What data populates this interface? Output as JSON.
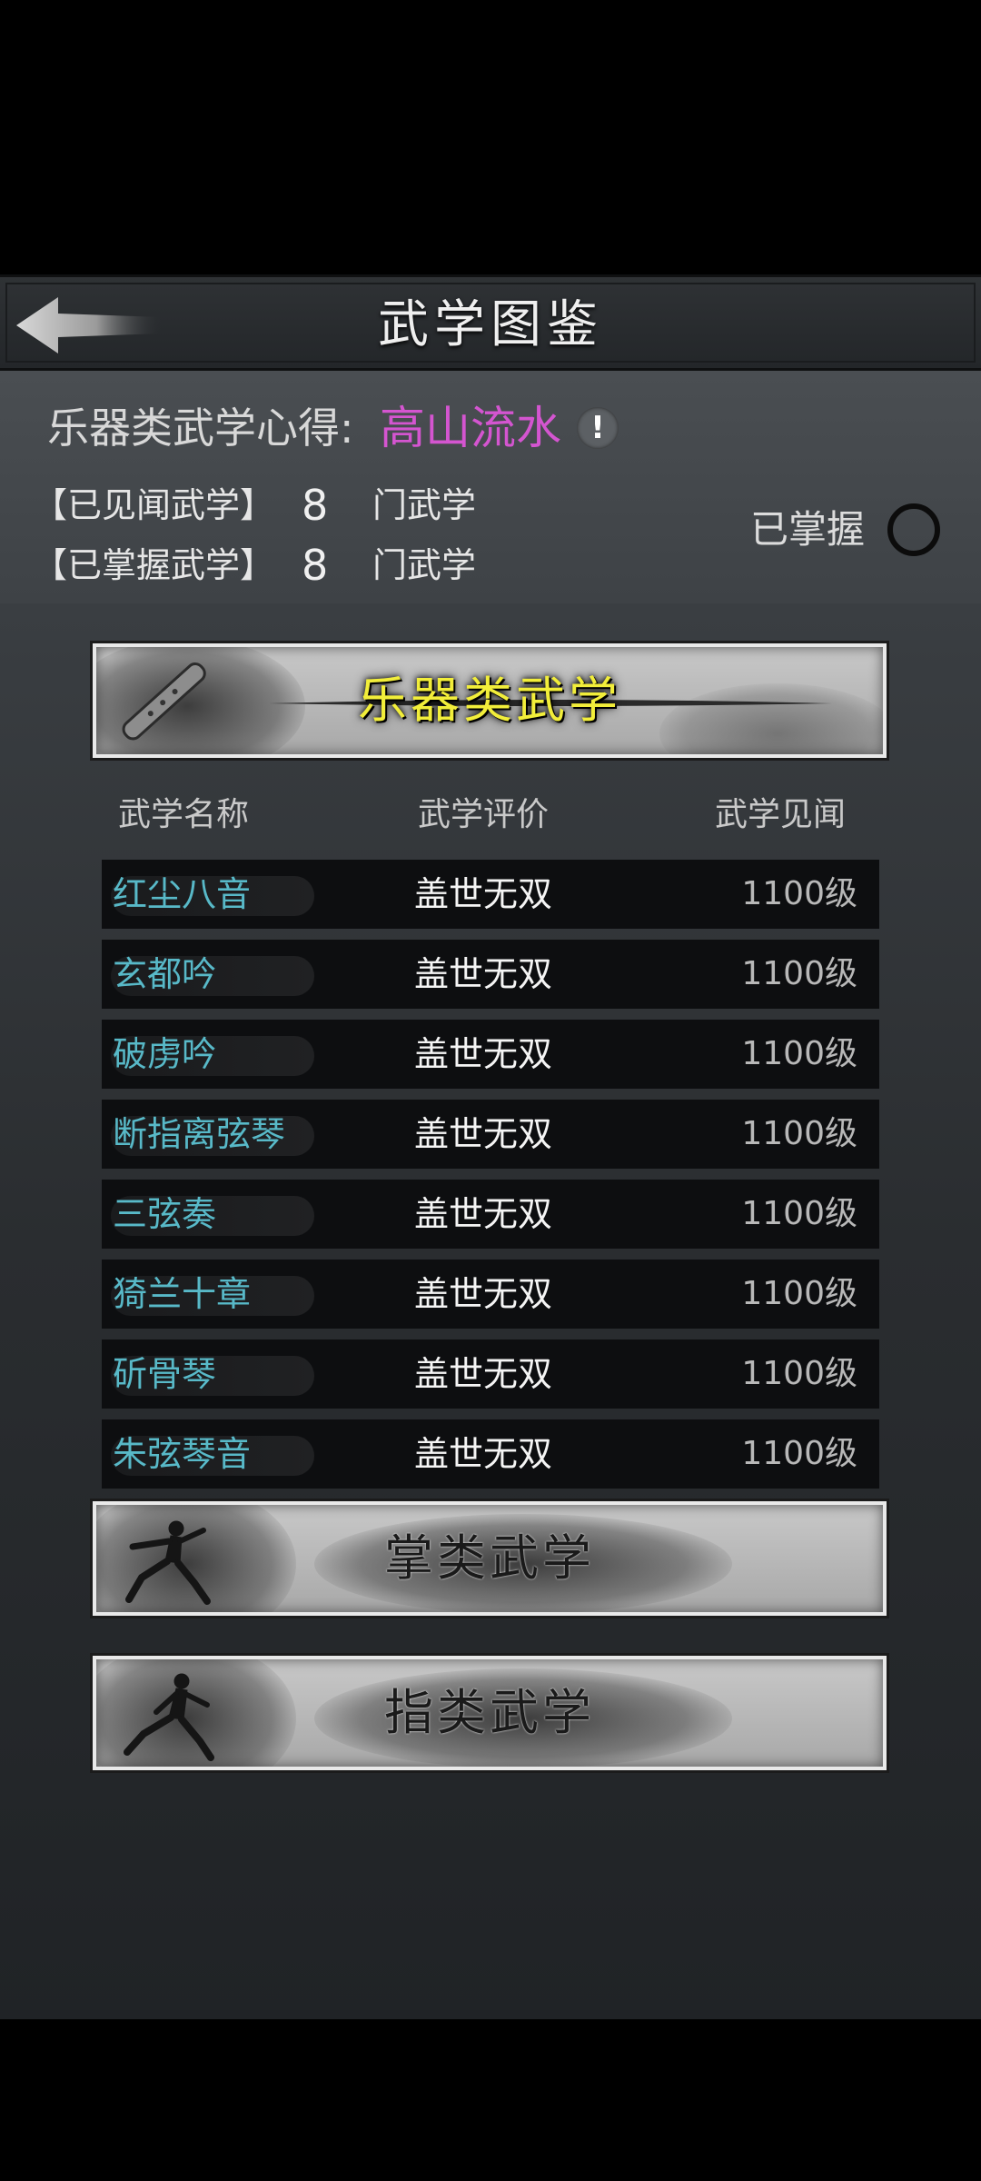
{
  "header": {
    "title": "武学图鉴"
  },
  "info": {
    "heart_label": "乐器类武学心得:",
    "heart_value": "高山流水",
    "heart_value_color": "#d455d0",
    "seen_label": "【已见闻武学】",
    "seen_count": "8",
    "seen_unit": "门武学",
    "mastered_label": "【已掌握武学】",
    "mastered_count": "8",
    "mastered_unit": "门武学",
    "filter_label": "已掌握"
  },
  "sections": {
    "instrument_label": "乐器类武学",
    "palm_label": "掌类武学",
    "finger_label": "指类武学"
  },
  "table": {
    "col_name": "武学名称",
    "col_rating": "武学评价",
    "col_level": "武学见闻",
    "rows": [
      {
        "name": "红尘八音",
        "rating": "盖世无双",
        "level": "1100级"
      },
      {
        "name": "玄都吟",
        "rating": "盖世无双",
        "level": "1100级"
      },
      {
        "name": "破虏吟",
        "rating": "盖世无双",
        "level": "1100级"
      },
      {
        "name": "断指离弦琴",
        "rating": "盖世无双",
        "level": "1100级"
      },
      {
        "name": "三弦奏",
        "rating": "盖世无双",
        "level": "1100级"
      },
      {
        "name": "猗兰十章",
        "rating": "盖世无双",
        "level": "1100级"
      },
      {
        "name": "斫骨琴",
        "rating": "盖世无双",
        "level": "1100级"
      },
      {
        "name": "朱弦琴音",
        "rating": "盖世无双",
        "level": "1100级"
      }
    ]
  },
  "icons": {
    "back": "back-arrow-icon",
    "info": "exclamation-icon",
    "filter": "ring-checkbox-icon",
    "flute": "flute-icon",
    "palm_figure": "martial-artist-palm-icon",
    "finger_figure": "martial-artist-finger-icon"
  },
  "colors": {
    "skill_name": "#58b9c8",
    "section_highlight": "#f2ee3a"
  }
}
